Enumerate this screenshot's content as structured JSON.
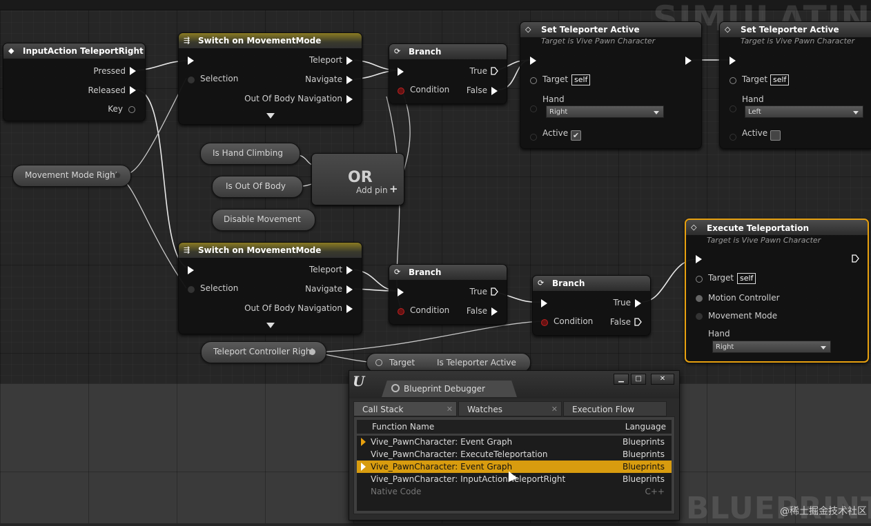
{
  "watermarks": {
    "top": "SIMULATING",
    "bottom": "BLUEPRINT",
    "credit": "@稀土掘金技术社区"
  },
  "nodes": {
    "input_action": {
      "title": "InputAction TeleportRight",
      "pins": [
        "Pressed",
        "Released",
        "Key"
      ]
    },
    "switch_top": {
      "title": "Switch on MovementMode",
      "input": "Selection",
      "outputs": [
        "Teleport",
        "Navigate",
        "Out Of Body Navigation"
      ]
    },
    "switch_bottom": {
      "title": "Switch on MovementMode",
      "input": "Selection",
      "outputs": [
        "Teleport",
        "Navigate",
        "Out Of Body Navigation"
      ]
    },
    "branch_top": {
      "title": "Branch",
      "condition": "Condition",
      "true": "True",
      "false": "False"
    },
    "branch_mid": {
      "title": "Branch",
      "condition": "Condition",
      "true": "True",
      "false": "False"
    },
    "branch_right": {
      "title": "Branch",
      "condition": "Condition",
      "true": "True",
      "false": "False"
    },
    "set_tp_right": {
      "title": "Set Teleporter Active",
      "subtitle": "Target is Vive Pawn Character",
      "target": "Target",
      "self": "self",
      "hand_label": "Hand",
      "hand_value": "Right",
      "active": "Active",
      "checked": true
    },
    "set_tp_left": {
      "title": "Set Teleporter Active",
      "subtitle": "Target is Vive Pawn Character",
      "target": "Target",
      "self": "self",
      "hand_label": "Hand",
      "hand_value": "Left",
      "active": "Active",
      "checked": false
    },
    "execute_tp": {
      "title": "Execute Teleportation",
      "subtitle": "Target is Vive Pawn Character",
      "target": "Target",
      "self": "self",
      "motion": "Motion Controller",
      "mode": "Movement Mode",
      "hand_label": "Hand",
      "hand_value": "Right"
    },
    "or_node": {
      "title": "OR",
      "add_pin": "Add pin"
    },
    "is_tp_active": {
      "target": "Target",
      "title": "Is Teleporter Active"
    }
  },
  "variables": {
    "movement_mode_right": "Movement Mode Right",
    "is_hand_climbing": "Is Hand Climbing",
    "is_out_of_body": "Is Out Of Body",
    "disable_movement": "Disable Movement",
    "teleport_controller_right": "Teleport Controller Right"
  },
  "debugger": {
    "window_title": "Blueprint Debugger",
    "tabs": [
      "Call Stack",
      "Watches",
      "Execution Flow"
    ],
    "columns": [
      "Function Name",
      "Language"
    ],
    "rows": [
      {
        "name": "Vive_PawnCharacter: Event Graph",
        "lang": "Blueprints"
      },
      {
        "name": "Vive_PawnCharacter: ExecuteTeleportation",
        "lang": "Blueprints"
      },
      {
        "name": "Vive_PawnCharacter: Event Graph",
        "lang": "Blueprints"
      },
      {
        "name": "Vive_PawnCharacter: InputAction TeleportRight",
        "lang": "Blueprints"
      },
      {
        "name": "Native Code",
        "lang": "C++"
      }
    ]
  }
}
